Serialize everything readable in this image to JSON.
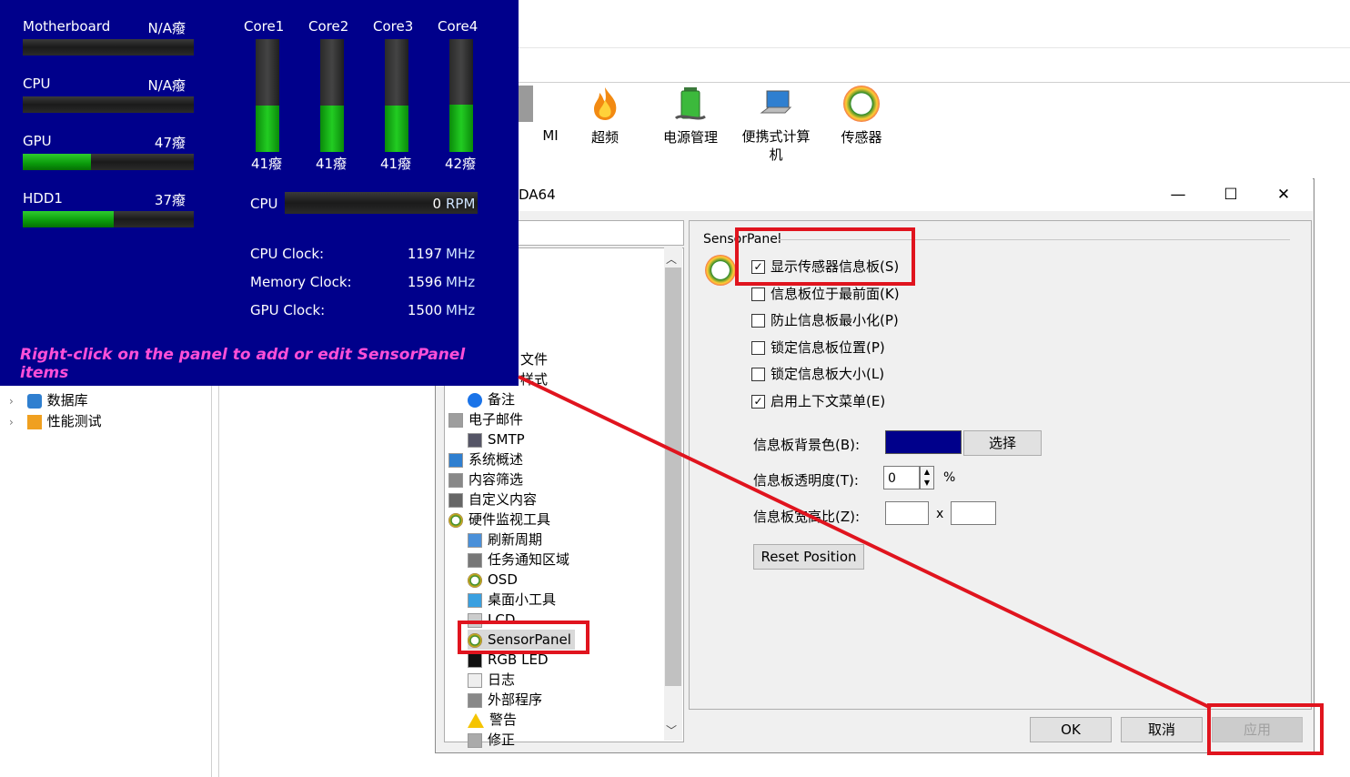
{
  "background": {
    "toolbar": [
      {
        "label": "MI",
        "icon": "dmi-icon"
      },
      {
        "label": "超频",
        "icon": "overclock-flame-icon"
      },
      {
        "label": "电源管理",
        "icon": "battery-icon"
      },
      {
        "label": "便携式计算\n机",
        "icon": "laptop-icon"
      },
      {
        "label": "传感器",
        "icon": "sensor-gauge-icon"
      }
    ],
    "left_tree": [
      {
        "label": "数据库"
      },
      {
        "label": "性能测试"
      }
    ]
  },
  "sensor_panel": {
    "bg_color": "#00008b",
    "left_items": [
      {
        "label": "Motherboard",
        "value": "N/A癈",
        "level": 0
      },
      {
        "label": "CPU",
        "value": "N/A癈",
        "level": 0
      },
      {
        "label": "GPU",
        "value": "47癈",
        "level": 0.4
      },
      {
        "label": "HDD1",
        "value": "37癈",
        "level": 0.53
      }
    ],
    "cores": [
      {
        "label": "Core1",
        "value": "41癈",
        "level": 0.41
      },
      {
        "label": "Core2",
        "value": "41癈",
        "level": 0.41
      },
      {
        "label": "Core3",
        "value": "41癈",
        "level": 0.41
      },
      {
        "label": "Core4",
        "value": "42癈",
        "level": 0.42
      }
    ],
    "fan": {
      "label": "CPU",
      "value": "0",
      "unit": "RPM"
    },
    "clocks": [
      {
        "label": "CPU Clock:",
        "value": "1197",
        "unit": "MHz"
      },
      {
        "label": "Memory Clock:",
        "value": "1596",
        "unit": "MHz"
      },
      {
        "label": "GPU Clock:",
        "value": "1500",
        "unit": "MHz"
      }
    ],
    "hint": "Right-click on the panel to add or edit SensorPanel items"
  },
  "dialog": {
    "title": "DA64",
    "minimize": "—",
    "maximize": "☐",
    "close": "✕",
    "tree_partial": [
      {
        "label": "文件"
      },
      {
        "label": "样式"
      }
    ],
    "tree": [
      {
        "label": "备注",
        "icon": "info-icon",
        "indent": 1
      },
      {
        "label": "电子邮件",
        "icon": "email-icon",
        "indent": 0
      },
      {
        "label": "SMTP",
        "icon": "smtp-icon",
        "indent": 1
      },
      {
        "label": "系统概述",
        "icon": "system-summary-icon",
        "indent": 0
      },
      {
        "label": "内容筛选",
        "icon": "filter-icon",
        "indent": 0
      },
      {
        "label": "自定义内容",
        "icon": "custom-content-icon",
        "indent": 0
      },
      {
        "label": "硬件监视工具",
        "icon": "hardware-monitor-icon",
        "indent": 0
      },
      {
        "label": "刷新周期",
        "icon": "refresh-clock-icon",
        "indent": 1
      },
      {
        "label": "任务通知区域",
        "icon": "tray-icon",
        "indent": 1
      },
      {
        "label": "OSD",
        "icon": "osd-gauge-icon",
        "indent": 1
      },
      {
        "label": "桌面小工具",
        "icon": "desktop-gadget-icon",
        "indent": 1
      },
      {
        "label": "LCD",
        "icon": "lcd-icon",
        "indent": 1
      },
      {
        "label": "SensorPanel",
        "icon": "sensorpanel-gauge-icon",
        "indent": 1
      },
      {
        "label": "RGB LED",
        "icon": "rgb-led-icon",
        "indent": 1
      },
      {
        "label": "日志",
        "icon": "log-icon",
        "indent": 1
      },
      {
        "label": "外部程序",
        "icon": "external-program-icon",
        "indent": 1
      },
      {
        "label": "警告",
        "icon": "warning-icon",
        "indent": 1
      },
      {
        "label": "修正",
        "icon": "correction-icon",
        "indent": 1
      }
    ],
    "group_title": "SensorPanel",
    "options": [
      {
        "label": "显示传感器信息板(S)",
        "checked": true
      },
      {
        "label": "信息板位于最前面(K)",
        "checked": false
      },
      {
        "label": "防止信息板最小化(P)",
        "checked": false
      },
      {
        "label": "锁定信息板位置(P)",
        "checked": false
      },
      {
        "label": "锁定信息板大小(L)",
        "checked": false
      },
      {
        "label": "启用上下文菜单(E)",
        "checked": true
      }
    ],
    "bg_color_label": "信息板背景色(B):",
    "bg_color_value": "#00008b",
    "choose_button": "选择",
    "transparency_label": "信息板透明度(T):",
    "transparency_value": "0",
    "percent": "%",
    "aspect_label": "信息板宽高比(Z):",
    "aspect_w": "",
    "aspect_h": "",
    "aspect_x": "x",
    "reset_button": "Reset Position",
    "ok": "OK",
    "cancel": "取消",
    "apply": "应用"
  },
  "annotation_color": "#e0141e"
}
